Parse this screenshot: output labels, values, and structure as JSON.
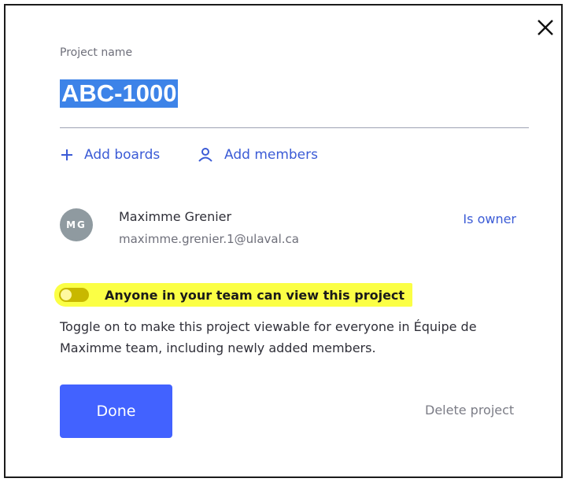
{
  "dialog": {
    "close_icon": "close-icon",
    "field_label": "Project name",
    "project_name": "ABC-1000",
    "actions": {
      "add_boards": "Add boards",
      "add_boards_icon": "plus-icon",
      "add_members": "Add members",
      "add_members_icon": "person-icon"
    },
    "member": {
      "initials": "MG",
      "name": "Maximme Grenier",
      "email": "maximme.grenier.1@ulaval.ca",
      "role": "Is owner"
    },
    "sharing": {
      "toggle_state": "off",
      "label": "Anyone in your team can view this project",
      "description": "Toggle on to make this project viewable for everyone in Équipe de Maximme team, including newly added members."
    },
    "buttons": {
      "done": "Done",
      "delete": "Delete project"
    }
  },
  "colors": {
    "accent": "#3b5bd6",
    "primary_button": "#4262ff",
    "highlight": "#fbff45",
    "selection": "#3d83e8",
    "avatar": "#8f9aa0"
  }
}
